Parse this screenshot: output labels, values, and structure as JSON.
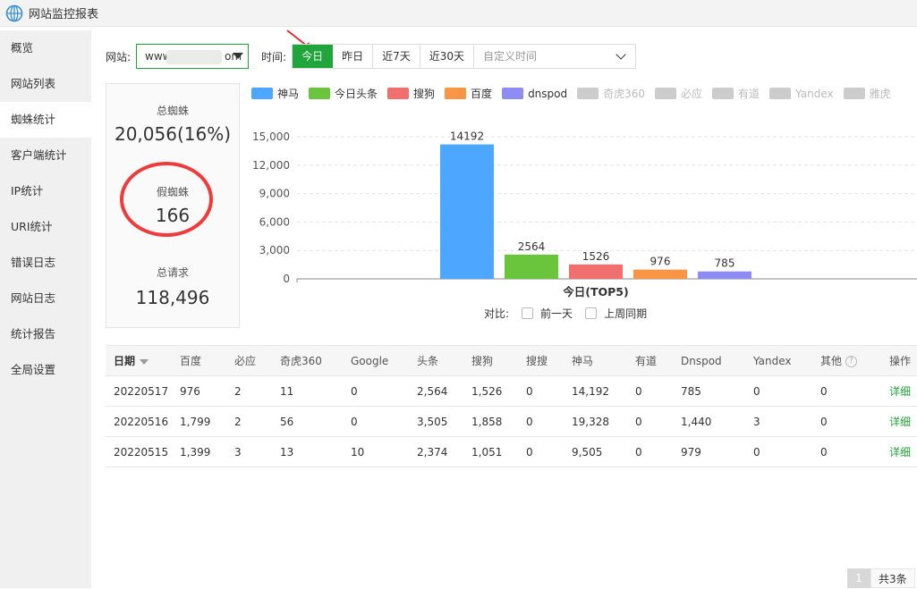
{
  "app": {
    "title": "网站监控报表"
  },
  "sidebar": {
    "items": [
      "概览",
      "网站列表",
      "蜘蛛统计",
      "客户端统计",
      "IP统计",
      "URI统计",
      "错误日志",
      "网站日志",
      "统计报告",
      "全局设置"
    ],
    "active_index": 2
  },
  "filter": {
    "site_label": "网站:",
    "site_prefix": "www",
    "site_suffix": "om",
    "time_label": "时间:",
    "buttons": [
      "今日",
      "昨日",
      "近7天",
      "近30天"
    ],
    "active_button": 0,
    "custom_placeholder": "自定义时间"
  },
  "stats": {
    "total_spiders_label": "总蜘蛛",
    "total_spiders_value": "20,056(16%)",
    "fake_spiders_label": "假蜘蛛",
    "fake_spiders_value": "166",
    "total_requests_label": "总请求",
    "total_requests_value": "118,496"
  },
  "legend": [
    {
      "name": "神马",
      "color": "#4da6ff",
      "active": true
    },
    {
      "name": "今日头条",
      "color": "#6ac53c",
      "active": true
    },
    {
      "name": "搜狗",
      "color": "#f26f6f",
      "active": true
    },
    {
      "name": "百度",
      "color": "#f89645",
      "active": true
    },
    {
      "name": "dnspod",
      "color": "#8c8cf2",
      "active": true
    },
    {
      "name": "奇虎360",
      "color": "#cccccc",
      "active": false
    },
    {
      "name": "必应",
      "color": "#cccccc",
      "active": false
    },
    {
      "name": "有道",
      "color": "#cccccc",
      "active": false
    },
    {
      "name": "Yandex",
      "color": "#cccccc",
      "active": false
    },
    {
      "name": "雅虎",
      "color": "#cccccc",
      "active": false
    }
  ],
  "chart_data": {
    "type": "bar",
    "categories": [
      "神马",
      "今日头条",
      "搜狗",
      "百度",
      "dnspod"
    ],
    "values": [
      14192,
      2564,
      1526,
      976,
      785
    ],
    "colors": [
      "#4da6ff",
      "#6ac53c",
      "#f26f6f",
      "#f89645",
      "#8c8cf2"
    ],
    "xlabel": "今日(TOP5)",
    "yticks": [
      "0",
      "3,000",
      "6,000",
      "9,000",
      "12,000",
      "15,000"
    ],
    "ylim": [
      0,
      15000
    ],
    "grid": true
  },
  "compare": {
    "label": "对比:",
    "options": [
      "前一天",
      "上周同期"
    ]
  },
  "table": {
    "headers": [
      "日期",
      "百度",
      "必应",
      "奇虎360",
      "Google",
      "头条",
      "搜狗",
      "搜搜",
      "神马",
      "有道",
      "Dnspod",
      "Yandex",
      "其他",
      "操作"
    ],
    "rows": [
      [
        "20220517",
        "976",
        "2",
        "11",
        "0",
        "2,564",
        "1,526",
        "0",
        "14,192",
        "0",
        "785",
        "0",
        "0",
        "详细"
      ],
      [
        "20220516",
        "1,799",
        "2",
        "56",
        "0",
        "3,505",
        "1,858",
        "0",
        "19,328",
        "0",
        "1,440",
        "3",
        "0",
        "详细"
      ],
      [
        "20220515",
        "1,399",
        "3",
        "13",
        "10",
        "2,374",
        "1,051",
        "0",
        "9,505",
        "0",
        "979",
        "0",
        "0",
        "详细"
      ]
    ]
  },
  "pager": {
    "current": "1",
    "total": "共3条"
  }
}
